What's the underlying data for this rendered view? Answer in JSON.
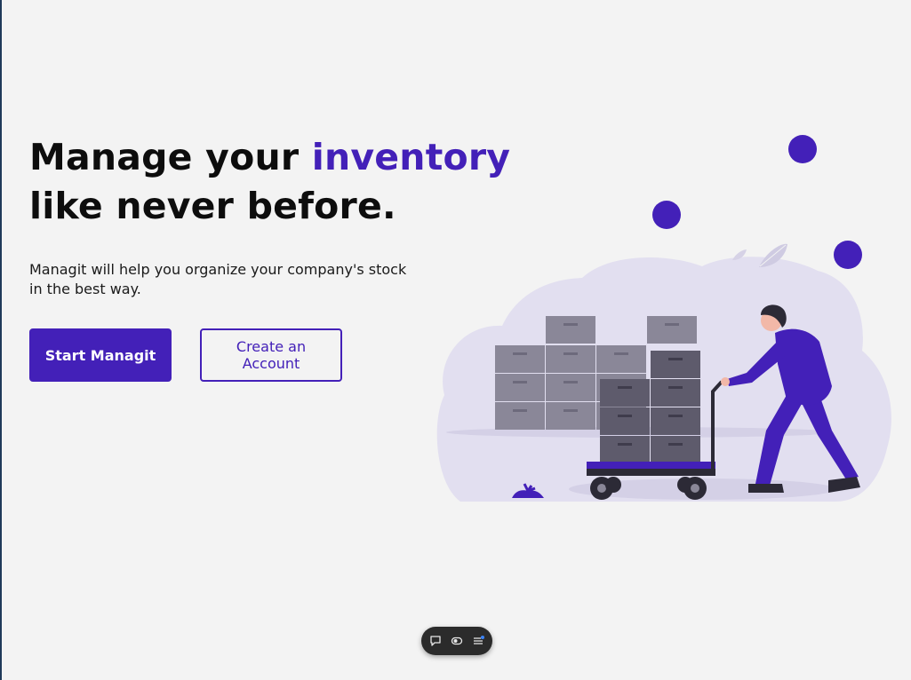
{
  "hero": {
    "headline_part1": "Manage your ",
    "headline_accent": "inventory",
    "headline_part2": "like never before.",
    "subtitle": "Managit will help you organize your company's stock in the best way."
  },
  "actions": {
    "primary_label": "Start Managit",
    "secondary_label": "Create an Account"
  },
  "illustration": {
    "subject": "person pushing cart with boxes"
  },
  "toolbar": {
    "icons": [
      "chat-icon",
      "toggle-icon",
      "menu-icon"
    ]
  },
  "colors": {
    "accent": "#4320b8",
    "background": "#f3f3f3",
    "text": "#0d0d0d",
    "toolbar": "#2b2b2b"
  }
}
